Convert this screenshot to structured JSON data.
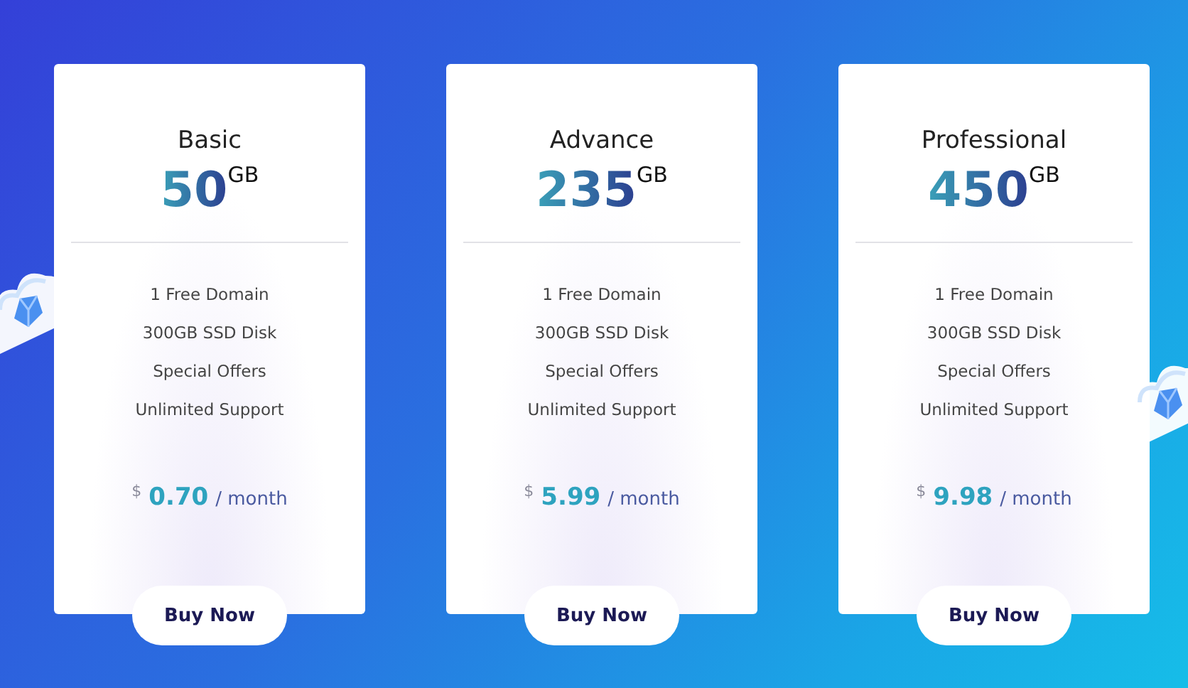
{
  "plans": [
    {
      "name": "Basic",
      "size": "50",
      "unit": "GB",
      "features": [
        "1 Free Domain",
        "300GB SSD Disk",
        "Special Offers",
        "Unlimited Support"
      ],
      "currency": "$",
      "price": "0.70",
      "period": "/ month",
      "button": "Buy Now"
    },
    {
      "name": "Advance",
      "size": "235",
      "unit": "GB",
      "features": [
        "1 Free Domain",
        "300GB SSD Disk",
        "Special Offers",
        "Unlimited Support"
      ],
      "currency": "$",
      "price": "5.99",
      "period": "/ month",
      "button": "Buy Now"
    },
    {
      "name": "Professional",
      "size": "450",
      "unit": "GB",
      "features": [
        "1 Free Domain",
        "300GB SSD Disk",
        "Special Offers",
        "Unlimited Support"
      ],
      "currency": "$",
      "price": "9.98",
      "period": "/ month",
      "button": "Buy Now"
    }
  ]
}
